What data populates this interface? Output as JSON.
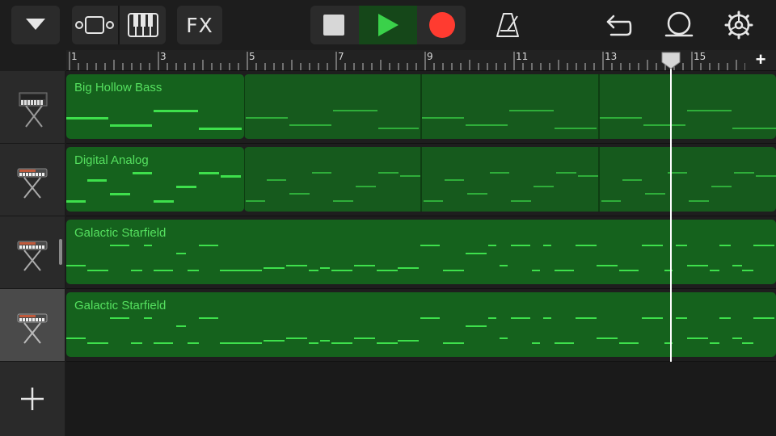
{
  "toolbar": {
    "fx_label": "FX",
    "icons": [
      "browser-dropdown-icon",
      "tracks-view-icon",
      "keyboard-icon",
      "fx-icon",
      "stop-icon",
      "play-icon",
      "record-icon",
      "metronome-icon",
      "undo-icon",
      "loop-icon",
      "settings-icon"
    ]
  },
  "ruler": {
    "labels": [
      "1",
      "3",
      "5",
      "7",
      "9",
      "11",
      "13",
      "15"
    ],
    "add_label": "+"
  },
  "tracks": [
    {
      "name": "Big Hollow Bass",
      "instrument_icon": "synth-bass-icon",
      "selected": false
    },
    {
      "name": "Digital Analog",
      "instrument_icon": "synth-keyboard-icon",
      "selected": false
    },
    {
      "name": "Galactic Starfield",
      "instrument_icon": "synth-keyboard-icon",
      "selected": false
    },
    {
      "name": "Galactic Starfield",
      "instrument_icon": "synth-keyboard-icon",
      "selected": true
    }
  ],
  "add_track_label": "+",
  "colors": {
    "region_fill": "#15621d",
    "region_text": "#55e05f",
    "note": "#3ee04c",
    "note_dim": "#2fae3a",
    "record": "#ff3b30",
    "play": "#3ad14a"
  }
}
